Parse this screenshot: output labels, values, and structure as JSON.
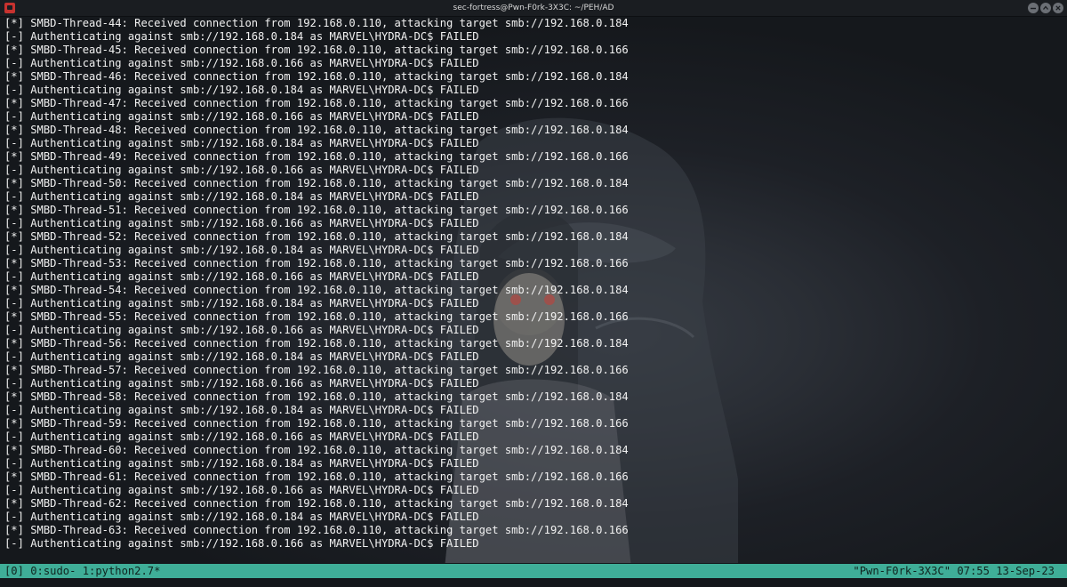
{
  "window": {
    "title": "sec-fortress@Pwn-F0rk-3X3C: ~/PEH/AD",
    "accent_color": "#c7322f"
  },
  "terminal": {
    "lines": [
      "[*] SMBD-Thread-44: Received connection from 192.168.0.110, attacking target smb://192.168.0.184",
      "[-] Authenticating against smb://192.168.0.184 as MARVEL\\HYDRA-DC$ FAILED",
      "[*] SMBD-Thread-45: Received connection from 192.168.0.110, attacking target smb://192.168.0.166",
      "[-] Authenticating against smb://192.168.0.166 as MARVEL\\HYDRA-DC$ FAILED",
      "[*] SMBD-Thread-46: Received connection from 192.168.0.110, attacking target smb://192.168.0.184",
      "[-] Authenticating against smb://192.168.0.184 as MARVEL\\HYDRA-DC$ FAILED",
      "[*] SMBD-Thread-47: Received connection from 192.168.0.110, attacking target smb://192.168.0.166",
      "[-] Authenticating against smb://192.168.0.166 as MARVEL\\HYDRA-DC$ FAILED",
      "[*] SMBD-Thread-48: Received connection from 192.168.0.110, attacking target smb://192.168.0.184",
      "[-] Authenticating against smb://192.168.0.184 as MARVEL\\HYDRA-DC$ FAILED",
      "[*] SMBD-Thread-49: Received connection from 192.168.0.110, attacking target smb://192.168.0.166",
      "[-] Authenticating against smb://192.168.0.166 as MARVEL\\HYDRA-DC$ FAILED",
      "[*] SMBD-Thread-50: Received connection from 192.168.0.110, attacking target smb://192.168.0.184",
      "[-] Authenticating against smb://192.168.0.184 as MARVEL\\HYDRA-DC$ FAILED",
      "[*] SMBD-Thread-51: Received connection from 192.168.0.110, attacking target smb://192.168.0.166",
      "[-] Authenticating against smb://192.168.0.166 as MARVEL\\HYDRA-DC$ FAILED",
      "[*] SMBD-Thread-52: Received connection from 192.168.0.110, attacking target smb://192.168.0.184",
      "[-] Authenticating against smb://192.168.0.184 as MARVEL\\HYDRA-DC$ FAILED",
      "[*] SMBD-Thread-53: Received connection from 192.168.0.110, attacking target smb://192.168.0.166",
      "[-] Authenticating against smb://192.168.0.166 as MARVEL\\HYDRA-DC$ FAILED",
      "[*] SMBD-Thread-54: Received connection from 192.168.0.110, attacking target smb://192.168.0.184",
      "[-] Authenticating against smb://192.168.0.184 as MARVEL\\HYDRA-DC$ FAILED",
      "[*] SMBD-Thread-55: Received connection from 192.168.0.110, attacking target smb://192.168.0.166",
      "[-] Authenticating against smb://192.168.0.166 as MARVEL\\HYDRA-DC$ FAILED",
      "[*] SMBD-Thread-56: Received connection from 192.168.0.110, attacking target smb://192.168.0.184",
      "[-] Authenticating against smb://192.168.0.184 as MARVEL\\HYDRA-DC$ FAILED",
      "[*] SMBD-Thread-57: Received connection from 192.168.0.110, attacking target smb://192.168.0.166",
      "[-] Authenticating against smb://192.168.0.166 as MARVEL\\HYDRA-DC$ FAILED",
      "[*] SMBD-Thread-58: Received connection from 192.168.0.110, attacking target smb://192.168.0.184",
      "[-] Authenticating against smb://192.168.0.184 as MARVEL\\HYDRA-DC$ FAILED",
      "[*] SMBD-Thread-59: Received connection from 192.168.0.110, attacking target smb://192.168.0.166",
      "[-] Authenticating against smb://192.168.0.166 as MARVEL\\HYDRA-DC$ FAILED",
      "[*] SMBD-Thread-60: Received connection from 192.168.0.110, attacking target smb://192.168.0.184",
      "[-] Authenticating against smb://192.168.0.184 as MARVEL\\HYDRA-DC$ FAILED",
      "[*] SMBD-Thread-61: Received connection from 192.168.0.110, attacking target smb://192.168.0.166",
      "[-] Authenticating against smb://192.168.0.166 as MARVEL\\HYDRA-DC$ FAILED",
      "[*] SMBD-Thread-62: Received connection from 192.168.0.110, attacking target smb://192.168.0.184",
      "[-] Authenticating against smb://192.168.0.184 as MARVEL\\HYDRA-DC$ FAILED",
      "[*] SMBD-Thread-63: Received connection from 192.168.0.110, attacking target smb://192.168.0.166",
      "[-] Authenticating against smb://192.168.0.166 as MARVEL\\HYDRA-DC$ FAILED"
    ]
  },
  "statusbar": {
    "sessions": "[0] 0:sudo- 1:python2.7*",
    "host": "\"Pwn-F0rk-3X3C\" 07:55 13-Sep-23",
    "color": "#3fae98"
  },
  "icons": [
    "terminal-app-icon",
    "minimize-icon",
    "maximize-icon",
    "close-icon"
  ]
}
